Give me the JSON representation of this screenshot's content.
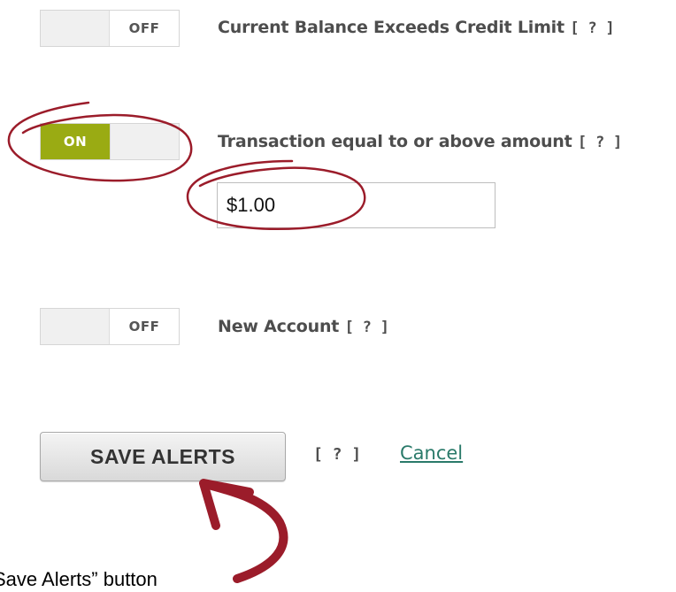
{
  "alerts": [
    {
      "state_label": "OFF",
      "label": "Current Balance Exceeds Credit Limit",
      "help": "[ ? ]",
      "enabled": false
    },
    {
      "state_label": "ON",
      "label": "Transaction equal to or above amount",
      "help": "[ ? ]",
      "enabled": true,
      "amount_value": "$1.00"
    },
    {
      "state_label": "OFF",
      "label": "New Account",
      "help": "[ ? ]",
      "enabled": false
    }
  ],
  "actions": {
    "save_label": "SAVE ALERTS",
    "help": "[ ? ]",
    "cancel_label": "Cancel"
  },
  "caption": "Save Alerts” button",
  "colors": {
    "toggle_on": "#9aab13",
    "link": "#2a7a6a",
    "annotation": "#9b1c2a"
  }
}
